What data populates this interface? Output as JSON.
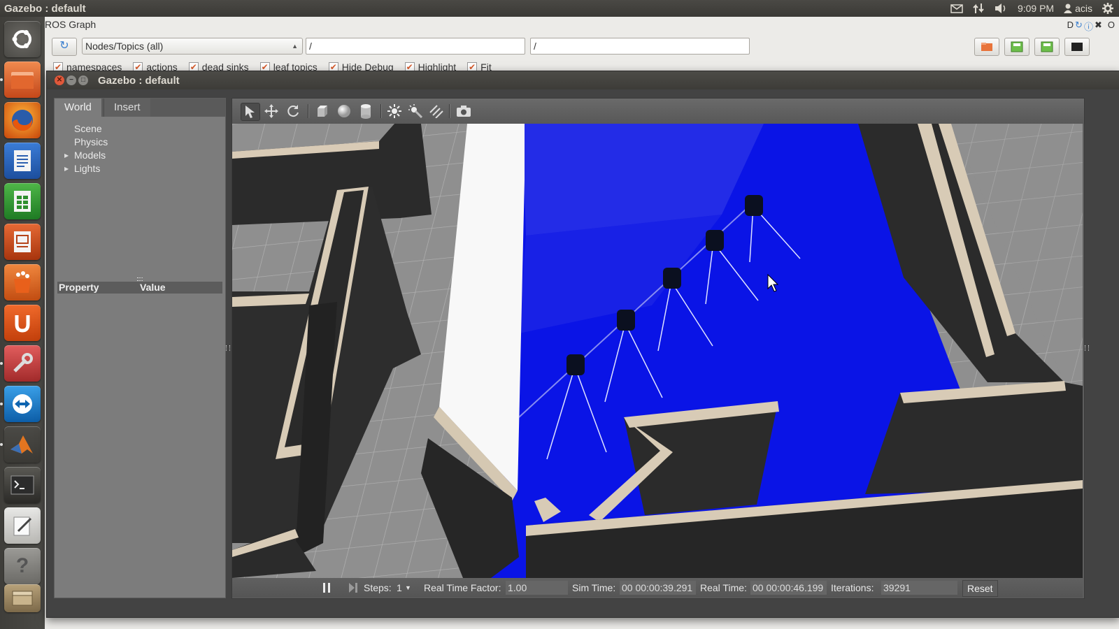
{
  "top_panel": {
    "title": "Gazebo : default",
    "time": "9:09 PM",
    "user": "acis"
  },
  "launcher": {
    "items": [
      "dash-home",
      "files",
      "firefox",
      "writer",
      "calc",
      "impress",
      "software-center",
      "ubuntu-one",
      "system-settings",
      "teamviewer",
      "matlab",
      "terminal",
      "text-editor",
      "help",
      "archive",
      "trash"
    ]
  },
  "ros_graph": {
    "title": "ROS Graph",
    "combo": "Nodes/Topics (all)",
    "filter1": "/",
    "filter2": "/",
    "checks": [
      "namespaces",
      "actions",
      "dead sinks",
      "leaf topics",
      "Hide Debug",
      "Highlight",
      "Fit"
    ],
    "top_right": "O"
  },
  "gazebo": {
    "title": "Gazebo : default",
    "tabs": [
      "World",
      "Insert"
    ],
    "tree": [
      {
        "label": "Scene",
        "expandable": false
      },
      {
        "label": "Physics",
        "expandable": false
      },
      {
        "label": "Models",
        "expandable": true
      },
      {
        "label": "Lights",
        "expandable": true
      }
    ],
    "prop_header": {
      "property": "Property",
      "value": "Value"
    },
    "bottom": {
      "steps_label": "Steps:",
      "steps_value": "1",
      "rtf_label": "Real Time Factor:",
      "rtf_value": "1.00",
      "sim_time_label": "Sim Time:",
      "sim_time_value": "00 00:00:39.291",
      "real_time_label": "Real Time:",
      "real_time_value": "00 00:00:46.199",
      "iterations_label": "Iterations:",
      "iterations_value": "39291",
      "reset_label": "Reset"
    }
  },
  "colors": {
    "laser_blue": "#0a14e6",
    "wall_dark": "#2b2b2b",
    "wall_cap": "#d8cbb6",
    "floor": "#8e8e8e"
  }
}
